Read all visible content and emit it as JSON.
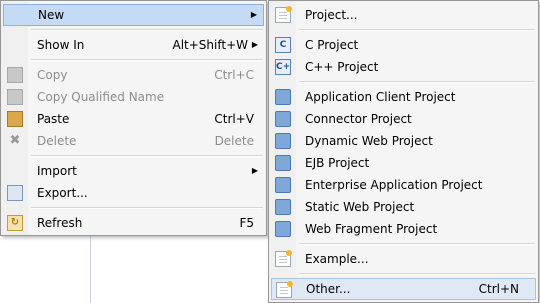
{
  "context_menu": {
    "items": [
      {
        "label": "New",
        "has_submenu": true
      },
      {
        "label": "Show In",
        "shortcut": "Alt+Shift+W",
        "has_submenu": true
      },
      {
        "label": "Copy",
        "shortcut": "Ctrl+C",
        "disabled": true,
        "icon": "copy-icon"
      },
      {
        "label": "Copy Qualified Name",
        "disabled": true,
        "icon": "copy-qualified-name-icon"
      },
      {
        "label": "Paste",
        "shortcut": "Ctrl+V",
        "icon": "paste-icon"
      },
      {
        "label": "Delete",
        "shortcut": "Delete",
        "disabled": true,
        "icon": "delete-icon"
      },
      {
        "label": "Import",
        "has_submenu": true,
        "icon": "import-icon"
      },
      {
        "label": "Export...",
        "icon": "export-icon"
      },
      {
        "label": "Refresh",
        "shortcut": "F5",
        "icon": "refresh-icon"
      }
    ],
    "submenu_arrow": "▶"
  },
  "new_submenu": {
    "items": [
      {
        "label": "Project...",
        "icon": "new-project-icon"
      },
      {
        "label": "C Project",
        "icon": "c-project-icon",
        "glyph": "C"
      },
      {
        "label": "C++ Project",
        "icon": "cpp-project-icon",
        "glyph": "C+"
      },
      {
        "label": "Application Client Project",
        "icon": "application-client-project-icon"
      },
      {
        "label": "Connector Project",
        "icon": "connector-project-icon"
      },
      {
        "label": "Dynamic Web Project",
        "icon": "dynamic-web-project-icon"
      },
      {
        "label": "EJB Project",
        "icon": "ejb-project-icon"
      },
      {
        "label": "Enterprise Application Project",
        "icon": "enterprise-application-project-icon"
      },
      {
        "label": "Static Web Project",
        "icon": "static-web-project-icon"
      },
      {
        "label": "Web Fragment Project",
        "icon": "web-fragment-project-icon"
      },
      {
        "label": "Example...",
        "icon": "example-icon"
      },
      {
        "label": "Other...",
        "shortcut": "Ctrl+N",
        "icon": "other-wizard-icon"
      }
    ]
  },
  "colors": {
    "highlight": "#c5daf3",
    "disabled_text": "#8d8d8d",
    "menu_background": "#f5f5f5"
  }
}
